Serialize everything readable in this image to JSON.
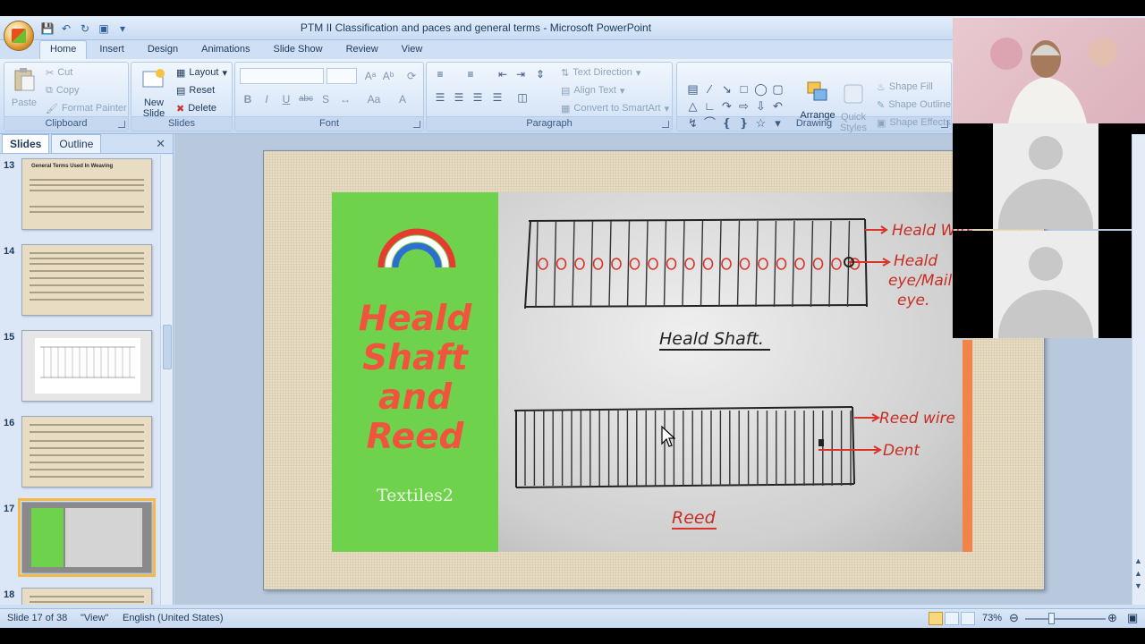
{
  "window": {
    "title": "PTM II Classification and paces and general terms - Microsoft PowerPoint"
  },
  "tabs": [
    "Home",
    "Insert",
    "Design",
    "Animations",
    "Slide Show",
    "Review",
    "View"
  ],
  "ribbon": {
    "clipboard": {
      "label": "Clipboard",
      "paste": "Paste",
      "cut": "Cut",
      "copy": "Copy",
      "format_painter": "Format Painter"
    },
    "slides": {
      "label": "Slides",
      "new_slide_line1": "New",
      "new_slide_line2": "Slide",
      "layout": "Layout",
      "reset": "Reset",
      "delete": "Delete"
    },
    "font": {
      "label": "Font"
    },
    "paragraph": {
      "label": "Paragraph",
      "text_direction": "Text Direction",
      "align_text": "Align Text",
      "convert_smartart": "Convert to SmartArt"
    },
    "drawing": {
      "label": "Drawing",
      "arrange": "Arrange",
      "quick_styles_line1": "Quick",
      "quick_styles_line2": "Styles",
      "shape_fill": "Shape Fill",
      "shape_outline": "Shape Outline",
      "shape_effects": "Shape Effects"
    }
  },
  "panel": {
    "tabs": [
      "Slides",
      "Outline"
    ],
    "thumbs": [
      {
        "num": "13",
        "title": "General Terms Used In Weaving"
      },
      {
        "num": "14",
        "title": ""
      },
      {
        "num": "15",
        "title": ""
      },
      {
        "num": "16",
        "title": ""
      },
      {
        "num": "17",
        "title": ""
      },
      {
        "num": "18",
        "title": ""
      }
    ],
    "selected": 17
  },
  "slide": {
    "title_lines": [
      "Heald",
      "Shaft",
      "and",
      "Reed"
    ],
    "subtitle": "Textiles2",
    "sketch_labels": {
      "heald_wire": "Heald Wire",
      "heald_eye_line1": "Heald",
      "heald_eye_line2": "eye/Mail",
      "heald_eye_line3": "eye.",
      "heald_shaft": "Heald Shaft.",
      "reed_wire": "Reed wire",
      "dent": "Dent",
      "reed": "Reed"
    }
  },
  "status": {
    "slide_info": "Slide 17 of 38",
    "theme": "\"View\"",
    "language": "English (United States)",
    "zoom": "73%"
  },
  "colors": {
    "accent_selection": "#f5b94a",
    "green_panel": "#6fd24c",
    "title_red": "#f0543c"
  }
}
